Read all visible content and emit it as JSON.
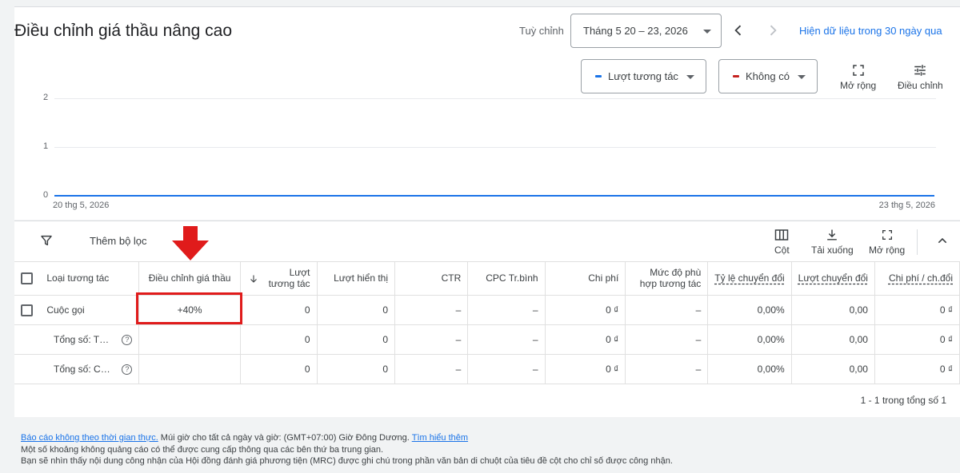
{
  "header": {
    "title": "Điều chỉnh giá thầu nâng cao",
    "range_label": "Tuỳ chỉnh",
    "date_range": "Tháng 5 20 – 23, 2026",
    "last_30_link": "Hiện dữ liệu trong 30 ngày qua"
  },
  "chart_controls": {
    "metric1": {
      "label": "Lượt tương tác",
      "color": "#1a73e8"
    },
    "metric2": {
      "label": "Không có",
      "color": "#c5221f"
    },
    "expand_label": "Mở rộng",
    "adjust_label": "Điều chỉnh"
  },
  "chart_data": {
    "type": "line",
    "x": [
      "20 thg 5, 2026",
      "23 thg 5, 2026"
    ],
    "series": [
      {
        "name": "Lượt tương tác",
        "values": [
          0,
          0
        ]
      }
    ],
    "y_ticks": [
      "0",
      "1",
      "2"
    ],
    "ylim": [
      0,
      2
    ],
    "grid": true
  },
  "table_toolbar": {
    "add_filter": "Thêm bộ lọc",
    "columns": "Cột",
    "download": "Tải xuống",
    "expand": "Mở rộng"
  },
  "table": {
    "headers": [
      "Loại tương tác",
      "Điều chỉnh giá thầu",
      "Lượt tương tác",
      "Lượt hiển thị",
      "CTR",
      "CPC Tr.bình",
      "Chi phí",
      "Mức độ phù hợp tương tác",
      "Tỷ lệ chuyển đổi",
      "Lượt chuyển đổi",
      "Chi phí / ch.đổi"
    ],
    "rows": [
      {
        "label": "Cuộc gọi",
        "bid": "+40%",
        "interactions": "0",
        "impressions": "0",
        "ctr": "–",
        "cpc": "–",
        "cost": "0 ₫",
        "relevance": "–",
        "conv_rate": "0,00%",
        "conversions": "0,00",
        "cost_per_conv": "0 ₫"
      },
      {
        "label": "Tổng số: Tương tác",
        "bid": "",
        "interactions": "0",
        "impressions": "0",
        "ctr": "–",
        "cpc": "–",
        "cost": "0 ₫",
        "relevance": "–",
        "conv_rate": "0,00%",
        "conversions": "0,00",
        "cost_per_conv": "0 ₫"
      },
      {
        "label": "Tổng số: Chiến dịch",
        "bid": "",
        "interactions": "0",
        "impressions": "0",
        "ctr": "–",
        "cpc": "–",
        "cost": "0 ₫",
        "relevance": "–",
        "conv_rate": "0,00%",
        "conversions": "0,00",
        "cost_per_conv": "0 ₫"
      }
    ],
    "pagination": "1 - 1 trong tổng số 1"
  },
  "footer": {
    "line1_link": "Báo cáo không theo thời gian thực.",
    "line1_text": " Múi giờ cho tất cả ngày và giờ: (GMT+07:00) Giờ Đông Dương. ",
    "line1_learn": "Tìm hiểu thêm",
    "line2": "Một số khoảng không quảng cáo có thể được cung cấp thông qua các bên thứ ba trung gian.",
    "line3": "Bạn sẽ nhìn thấy nội dung công nhận của Hội đồng đánh giá phương tiện (MRC) được ghi chú trong phần văn bản di chuột của tiêu đề cột cho chỉ số được công nhận."
  }
}
